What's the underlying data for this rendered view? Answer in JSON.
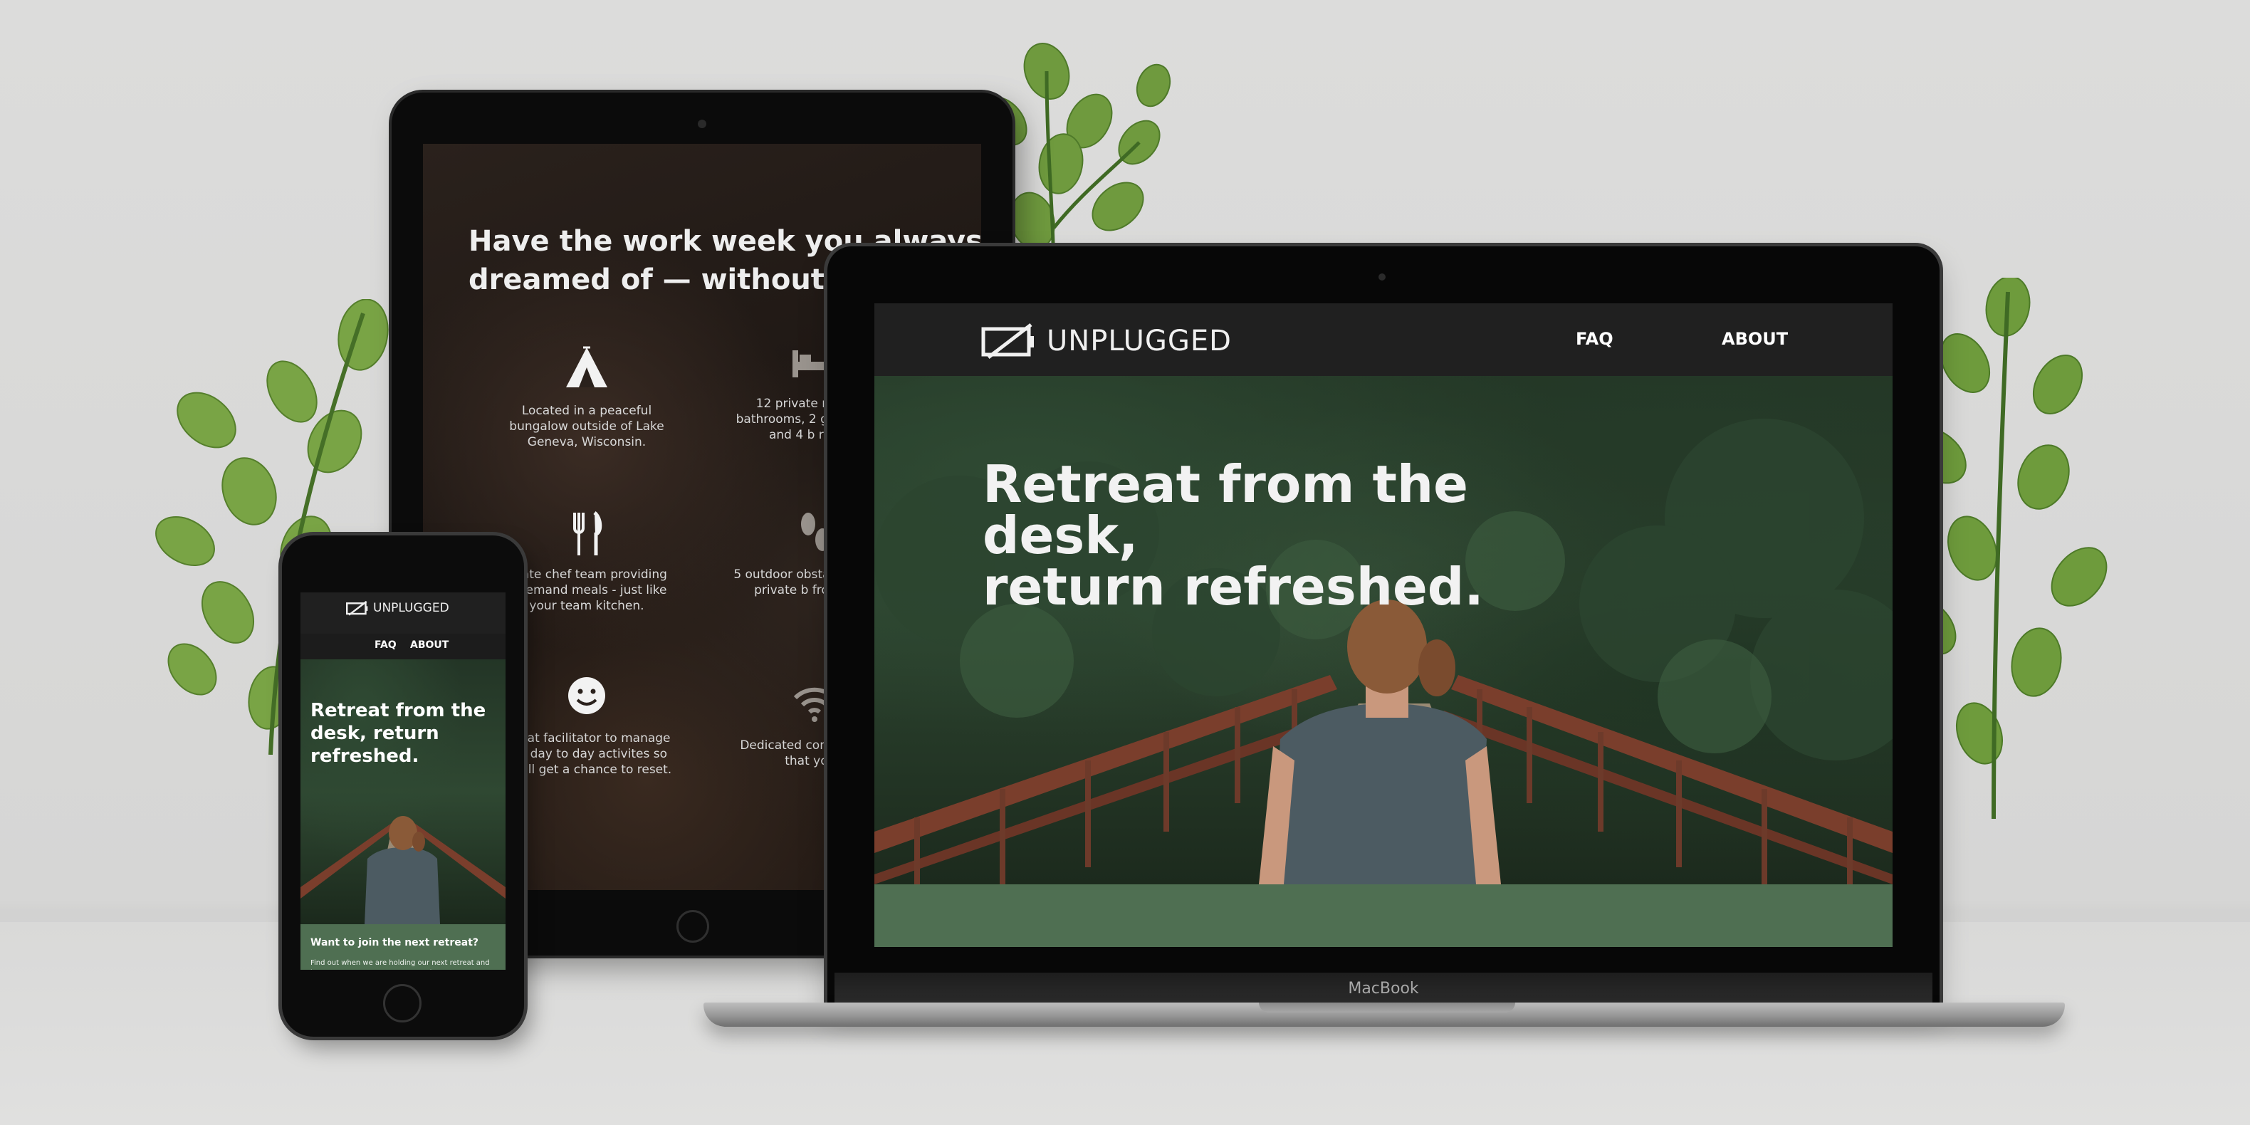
{
  "brand": {
    "name": "UNPLUGGED",
    "accent_green": "#4f6f52",
    "nav_bg": "#202020"
  },
  "laptop": {
    "model_label": "MacBook",
    "nav": {
      "faq_label": "FAQ",
      "about_label": "ABOUT"
    },
    "hero_title": "Retreat from the desk,\nreturn refreshed."
  },
  "tablet": {
    "heading": "Have the work week you always\ndreamed of — without the b",
    "features": [
      {
        "icon": "tent-icon",
        "text": "Located in a peaceful bungalow outside of Lake Geneva, Wisconsin."
      },
      {
        "icon": "bed-icon",
        "text": "12 private rooms w bathrooms, 2 grou rooms, and 4 b rooms."
      },
      {
        "icon": "fork-knife-icon",
        "text": "rivate chef team providing n demand meals - just like your team kitchen."
      },
      {
        "icon": "footprints-icon",
        "text": "5 outdoor obstac including private b from bung"
      },
      {
        "icon": "smiley-icon",
        "text": "etreat facilitator to manage our day to day activites so ou all get a chance to reset."
      },
      {
        "icon": "wifi-icon",
        "text": "Dedicated comput times that you r"
      }
    ]
  },
  "phone": {
    "nav": {
      "faq_label": "FAQ",
      "about_label": "ABOUT"
    },
    "hero_title": "Retreat from the\ndesk, return\nrefreshed.",
    "cta_title": "Want to join the next retreat?",
    "cta_text": "Find out when we are holding our next retreat and how your company or team can sign up!"
  }
}
